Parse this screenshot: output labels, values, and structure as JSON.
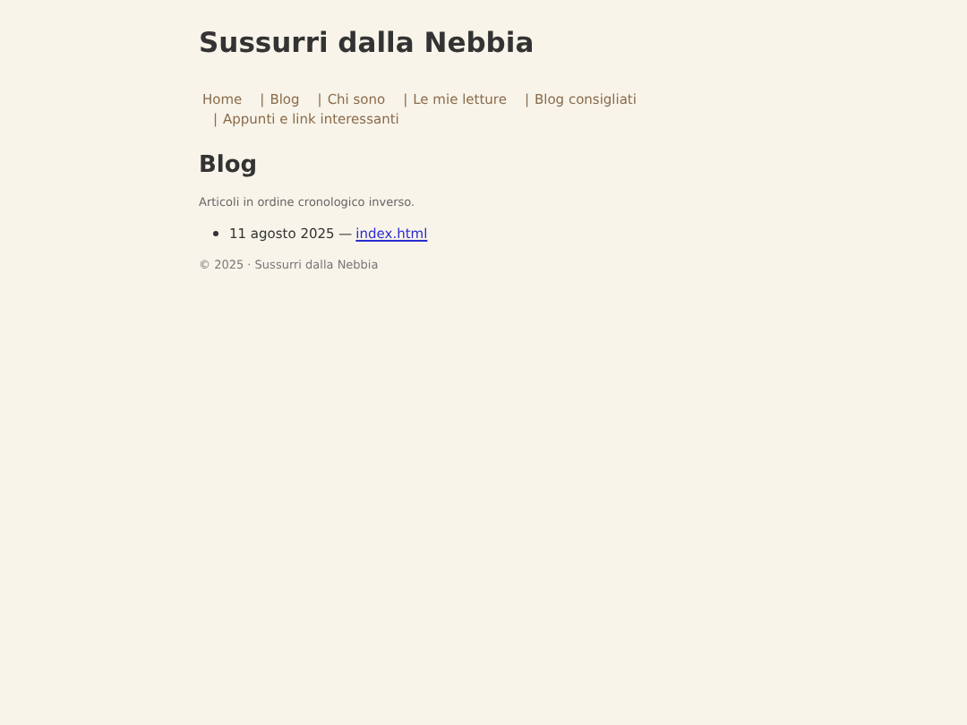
{
  "site_title": "Sussurri dalla Nebbia",
  "nav": [
    {
      "label": "Home"
    },
    {
      "separator": "|",
      "label": "Blog"
    },
    {
      "separator": "|",
      "label": "Chi sono"
    },
    {
      "separator": "|",
      "label": "Le mie letture"
    },
    {
      "separator": "|",
      "label": "Blog consigliati"
    },
    {
      "separator": "|",
      "label": "Appunti e link interessanti"
    }
  ],
  "heading": "Blog",
  "intro": "Articoli in ordine cronologico inverso.",
  "posts": [
    {
      "date": "11 agosto 2025 —",
      "link": "index.html"
    }
  ],
  "footer": "© 2025 · Sussurri dalla Nebbia"
}
